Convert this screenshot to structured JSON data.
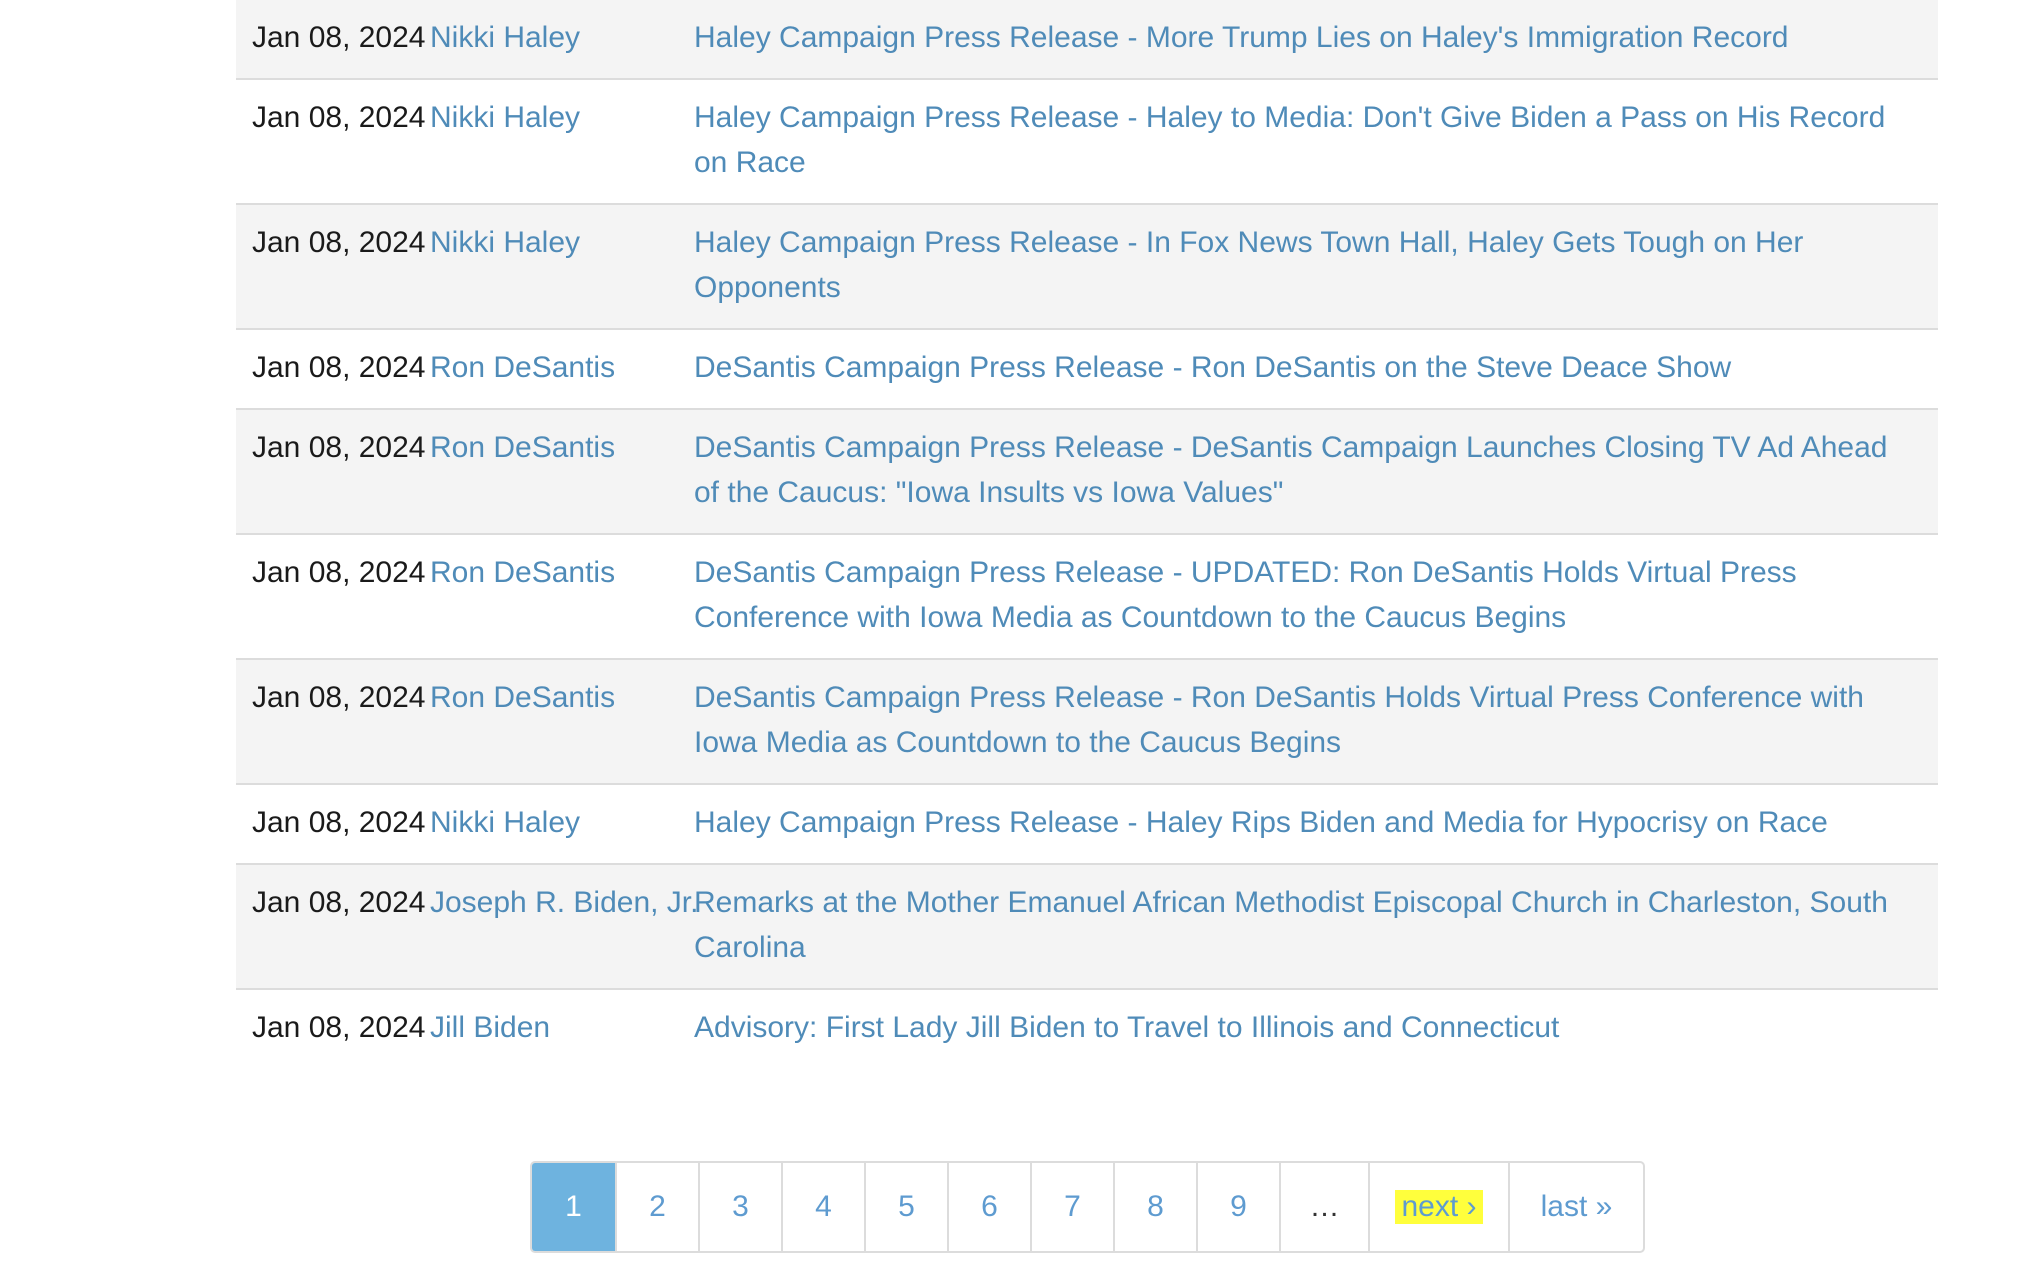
{
  "rows": [
    {
      "date": "Jan 08, 2024",
      "name": "Nikki Haley",
      "title": "Haley Campaign Press Release - More Trump Lies on Haley's Immigration Record"
    },
    {
      "date": "Jan 08, 2024",
      "name": "Nikki Haley",
      "title": "Haley Campaign Press Release - Haley to Media: Don't Give Biden a Pass on His Record on Race"
    },
    {
      "date": "Jan 08, 2024",
      "name": "Nikki Haley",
      "title": "Haley Campaign Press Release - In Fox News Town Hall, Haley Gets Tough on Her Opponents"
    },
    {
      "date": "Jan 08, 2024",
      "name": "Ron DeSantis",
      "title": "DeSantis Campaign Press Release - Ron DeSantis on the Steve Deace Show"
    },
    {
      "date": "Jan 08, 2024",
      "name": "Ron DeSantis",
      "title": "DeSantis Campaign Press Release - DeSantis Campaign Launches Closing TV Ad Ahead of the Caucus: \"Iowa Insults vs Iowa Values\""
    },
    {
      "date": "Jan 08, 2024",
      "name": "Ron DeSantis",
      "title": "DeSantis Campaign Press Release - UPDATED: Ron DeSantis Holds Virtual Press Conference with Iowa Media as Countdown to the Caucus Begins"
    },
    {
      "date": "Jan 08, 2024",
      "name": "Ron DeSantis",
      "title": "DeSantis Campaign Press Release - Ron DeSantis Holds Virtual Press Conference with Iowa Media as Countdown to the Caucus Begins"
    },
    {
      "date": "Jan 08, 2024",
      "name": "Nikki Haley",
      "title": "Haley Campaign Press Release - Haley Rips Biden and Media for Hypocrisy on Race"
    },
    {
      "date": "Jan 08, 2024",
      "name": "Joseph R. Biden, Jr.",
      "title": "Remarks at the Mother Emanuel African Methodist Episcopal Church in Charleston, South Carolina"
    },
    {
      "date": "Jan 08, 2024",
      "name": "Jill Biden",
      "title": "Advisory: First Lady Jill Biden to Travel to Illinois and Connecticut"
    }
  ],
  "pager": {
    "pages": [
      "1",
      "2",
      "3",
      "4",
      "5",
      "6",
      "7",
      "8",
      "9"
    ],
    "current": "1",
    "ellipsis": "…",
    "next_label": "next ›",
    "last_label": "last »"
  },
  "colors": {
    "link": "#4f8bb8",
    "active_page_bg": "#6eb3df",
    "highlight": "#ffff3c",
    "stripe": "#f4f4f4"
  }
}
